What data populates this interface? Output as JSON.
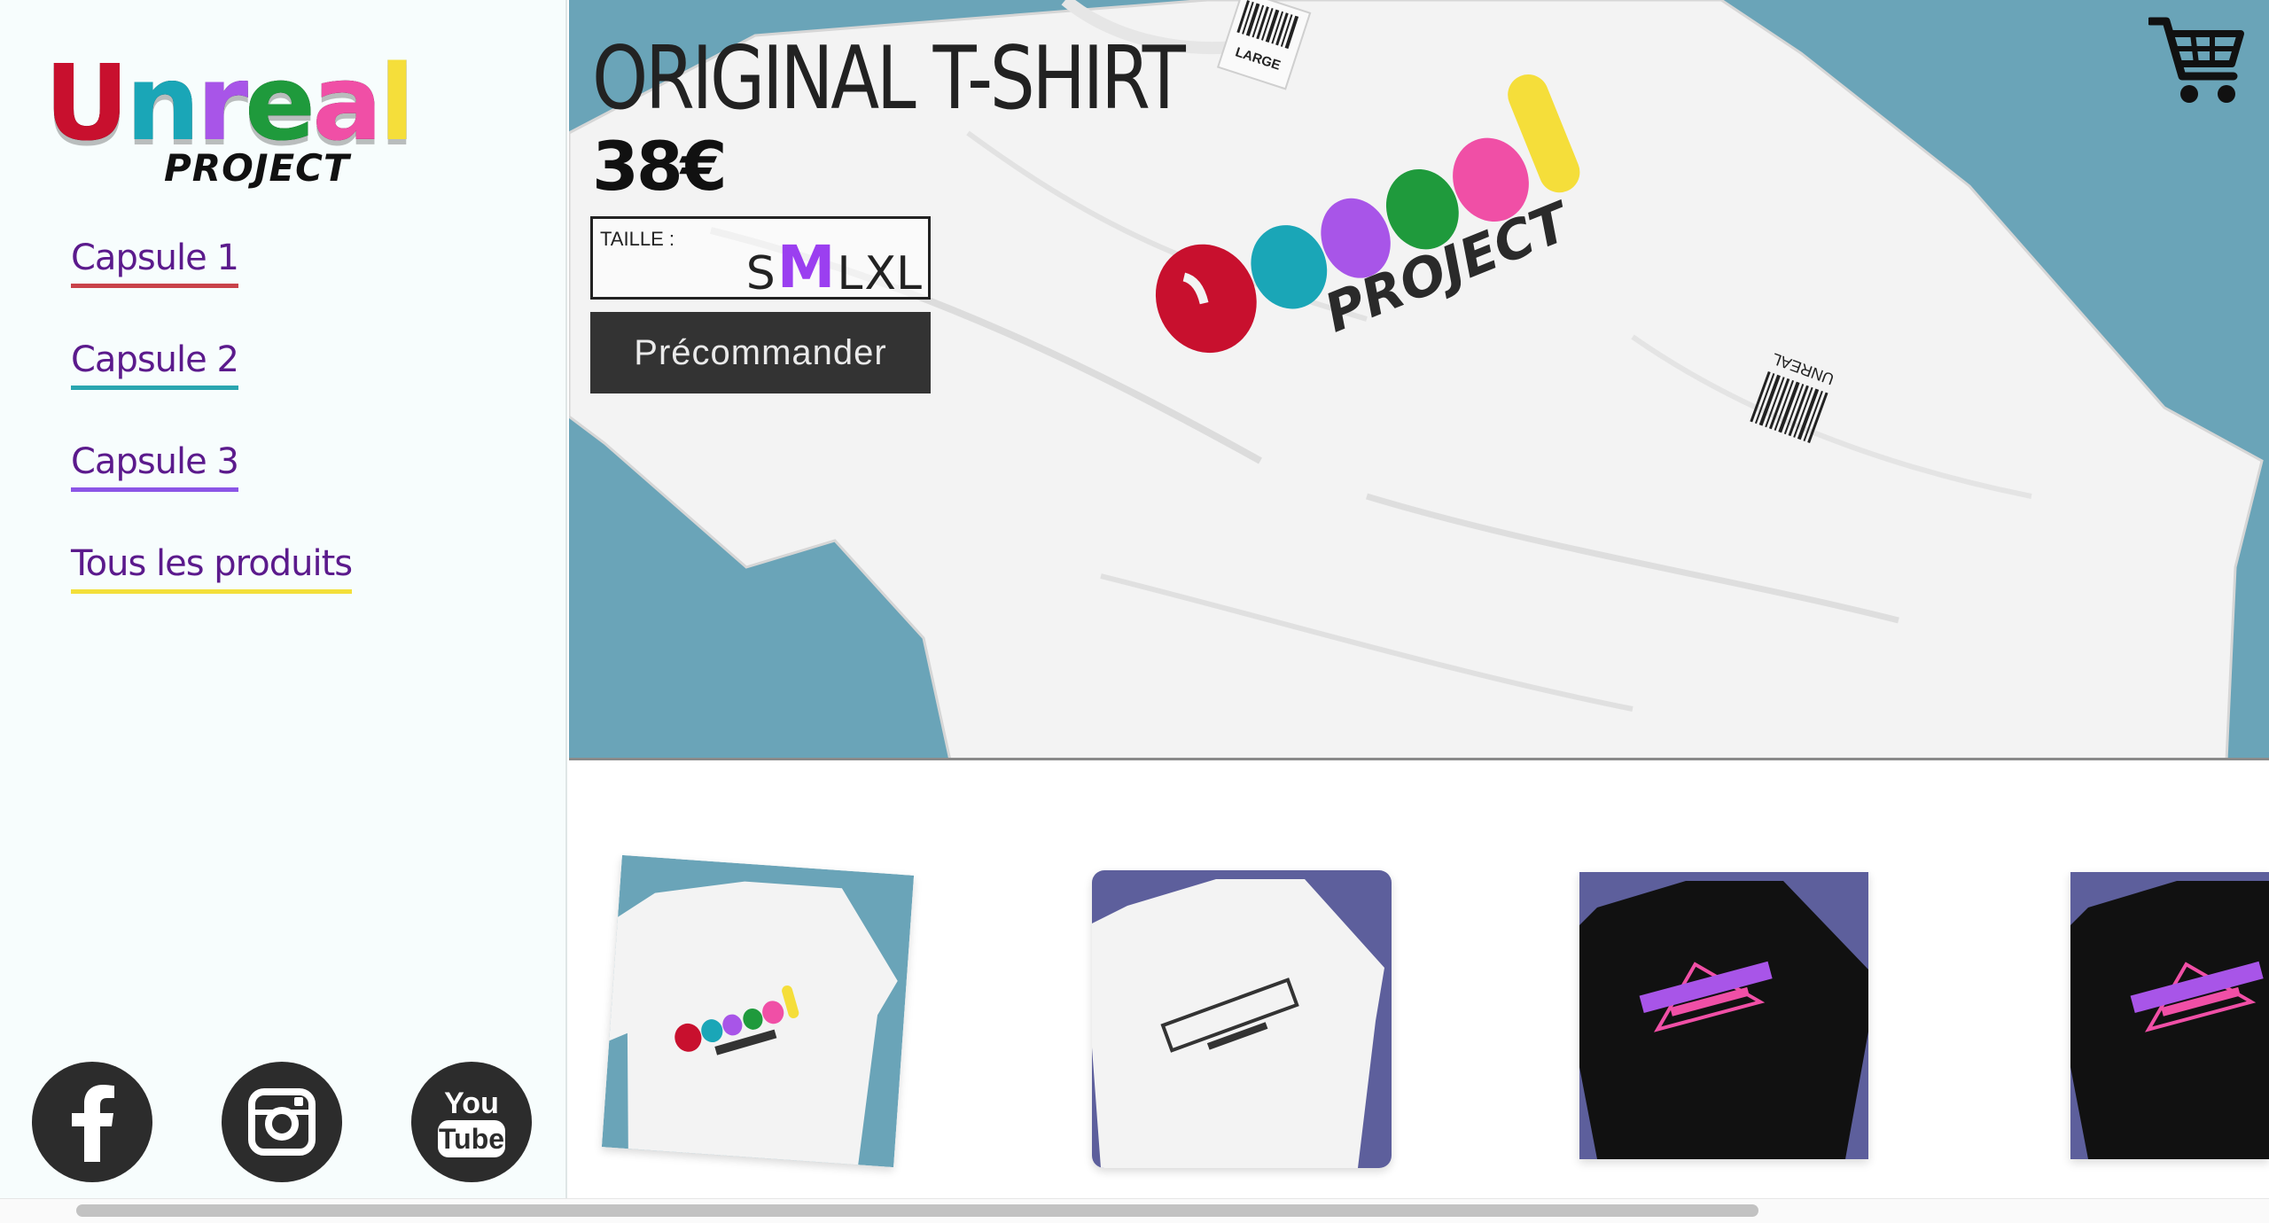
{
  "brand": {
    "logo_word_letters": [
      "U",
      "n",
      "r",
      "e",
      "a",
      "l"
    ],
    "logo_word_colors": [
      "#c8102e",
      "#1aa6b7",
      "#a855e8",
      "#1f9a3c",
      "#f04fa6",
      "#f5de3a"
    ],
    "logo_sub": "PROJECT"
  },
  "nav": {
    "items": [
      {
        "label": "Capsule 1",
        "underline_color": "#c9424a"
      },
      {
        "label": "Capsule 2",
        "underline_color": "#2aa6b0"
      },
      {
        "label": "Capsule 3",
        "underline_color": "#8b55e6"
      },
      {
        "label": "Tous les produits",
        "underline_color": "#f3df3a"
      }
    ]
  },
  "socials": [
    {
      "name": "facebook-icon"
    },
    {
      "name": "instagram-icon"
    },
    {
      "name": "youtube-icon",
      "line1": "You",
      "line2": "Tube"
    }
  ],
  "product": {
    "title": "ORIGINAL T-SHIRT",
    "price": "38€",
    "size_label": "TAILLE :",
    "sizes": [
      "S",
      "M",
      "L",
      "XL"
    ],
    "selected_size": "M",
    "preorder_label": "Précommander",
    "accent_color": "#9b3ff0",
    "shirt_print_brand": "PROJECT",
    "tag_text": "LARGE",
    "sleeve_text": "UNREAL"
  },
  "thumbnails": [
    {
      "name": "thumb-original-white",
      "shirt_color": "#ffffff",
      "bg": "#6aa4b8"
    },
    {
      "name": "thumb-outline-white",
      "shirt_color": "#ffffff",
      "bg": "#5d5f9c"
    },
    {
      "name": "thumb-retro-black",
      "shirt_color": "#111111",
      "bg": "#5d5f9c"
    },
    {
      "name": "thumb-retro-black-2",
      "shirt_color": "#111111",
      "bg": "#5d5f9c"
    }
  ]
}
